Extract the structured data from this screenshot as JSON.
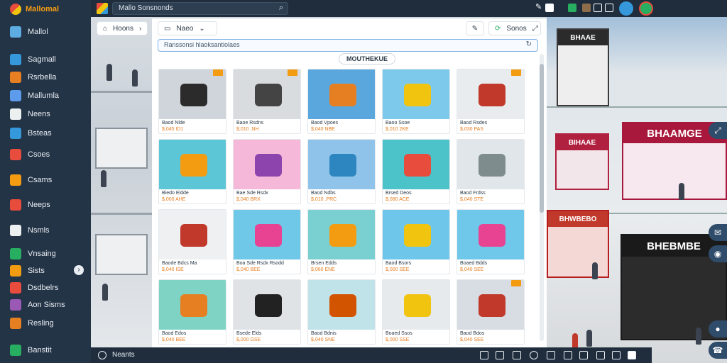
{
  "sidebar": {
    "brand": "Mallomal",
    "items": [
      {
        "label": "Mallol",
        "icon": "shopping-bag-icon",
        "color": "#5dade2"
      },
      {
        "label": "Sagmall",
        "icon": "globe-icon",
        "color": "#3498db"
      },
      {
        "label": "Rsrbella",
        "icon": "toy-blocks-icon",
        "color": "#e67e22"
      },
      {
        "label": "Mallumla",
        "icon": "document-icon",
        "color": "#5d9cec"
      },
      {
        "label": "Neens",
        "icon": "grid-icon",
        "color": "#ecf0f1"
      },
      {
        "label": "Bsteas",
        "icon": "bookmark-icon",
        "color": "#3498db"
      },
      {
        "label": "Csoes",
        "icon": "puzzle-icon",
        "color": "#e74c3c"
      },
      {
        "label": "Csams",
        "icon": "store-icon",
        "color": "#f39c12"
      },
      {
        "label": "Neeps",
        "icon": "clipboard-icon",
        "color": "#e74c3c"
      },
      {
        "label": "Nsmls",
        "icon": "list-icon",
        "color": "#ecf0f1"
      },
      {
        "label": "Vnsaing",
        "icon": "globe-icon",
        "color": "#27ae60"
      },
      {
        "label": "Sists",
        "icon": "pencil-icon",
        "color": "#f39c12"
      },
      {
        "label": "Dsdbelrs",
        "icon": "blocks-icon",
        "color": "#e74c3c"
      },
      {
        "label": "Aon Sisms",
        "icon": "chart-icon",
        "color": "#9b59b6"
      },
      {
        "label": "Resling",
        "icon": "car-toy-icon",
        "color": "#e67e22"
      },
      {
        "label": "Banstit",
        "icon": "gift-icon",
        "color": "#27ae60"
      }
    ],
    "toggle_glyph": "›"
  },
  "topbar": {
    "search_value": "Mallo Sonsnonds",
    "search_icon": "magnifier-icon"
  },
  "filters": {
    "chip1": "Hoons",
    "chip2": "Naeo",
    "chip3": "Sonos"
  },
  "url": {
    "value": "Ranssonsi hlaoksantiolaes"
  },
  "section_label": "MOUTHEKUE",
  "cards": [
    {
      "t1": "Baod Nlde",
      "t2": "$,045 ID1",
      "badge": true,
      "scene": "store"
    },
    {
      "t1": "Baoe Rsdns",
      "t2": "$,010 ,NH",
      "badge": true,
      "scene": "store2"
    },
    {
      "t1": "Baod Vpoes",
      "t2": "$,040 NBE",
      "badge": false,
      "scene": "truck-store"
    },
    {
      "t1": "Baoo Ssoe",
      "t2": "$,010 2KE",
      "badge": false,
      "scene": "yellow-toy"
    },
    {
      "t1": "Baod Rsdes",
      "t2": "$,030 PAS",
      "badge": true,
      "scene": "red-cart"
    },
    {
      "t1": "Biedo Eldde",
      "t2": "$,000 AHE",
      "badge": false,
      "scene": "orange-toy"
    },
    {
      "t1": "Bae Sde Rsdx",
      "t2": "$,040 BRX",
      "badge": false,
      "scene": "pink-truck"
    },
    {
      "t1": "Baod Ndbs",
      "t2": "$,010 .PRC",
      "badge": false,
      "scene": "jeep"
    },
    {
      "t1": "Brsed Deos",
      "t2": "$,080 ACE",
      "badge": false,
      "scene": "tool-toy"
    },
    {
      "t1": "Baod Frdss",
      "t2": "$,040 STE",
      "badge": false,
      "scene": "corridor"
    },
    {
      "t1": "Baode Bdcs Ma",
      "t2": "$,040 ISE",
      "badge": false,
      "scene": "shop-interior"
    },
    {
      "t1": "Boa Sde Rsdx Rsodd",
      "t2": "$,040 BEE",
      "badge": false,
      "scene": "pink-box"
    },
    {
      "t1": "Brsen Edds",
      "t2": "$,060 ENE",
      "badge": false,
      "scene": "flower-truck"
    },
    {
      "t1": "Baod Bsors",
      "t2": "$,000 SEE",
      "badge": false,
      "scene": "yellow-car"
    },
    {
      "t1": "Boaed Bdds",
      "t2": "$,040 SEE",
      "badge": false,
      "scene": "pink-cart"
    },
    {
      "t1": "Baod Edos",
      "t2": "$,040 BEE",
      "badge": false,
      "scene": "figures"
    },
    {
      "t1": "Bsede Elds",
      "t2": "$,000 GSE",
      "badge": false,
      "scene": "store-dark"
    },
    {
      "t1": "Baod Bdnis",
      "t2": "$,040 SNE",
      "badge": false,
      "scene": "bus-toy"
    },
    {
      "t1": "Boaed Ssos",
      "t2": "$,000 SSE",
      "badge": false,
      "scene": "crane-toy"
    },
    {
      "t1": "Baod Bdos",
      "t2": "$,040 SEE",
      "badge": true,
      "scene": "kiosk"
    }
  ],
  "bottombar": {
    "label": "Neants"
  },
  "mall_signs": {
    "top": "BHAAE",
    "mid": "BHAAMGE",
    "mid_left": "BIHAAE",
    "low_left": "BHWBEBO",
    "low": "BHEBMBE"
  },
  "accent": "#f39c12"
}
